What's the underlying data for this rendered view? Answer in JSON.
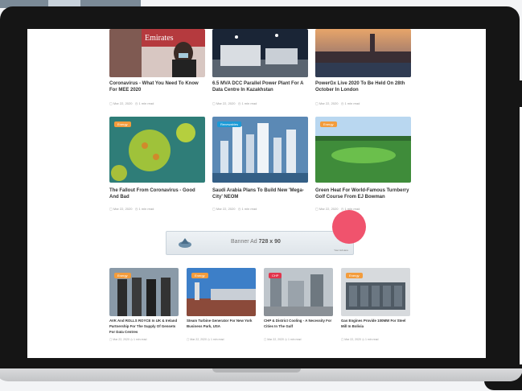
{
  "row1": [
    {
      "title": "Coronavirus - What You Need To Know For MEE 2020",
      "date": "Mar 22, 2020",
      "read": "1 min read"
    },
    {
      "title": "6.5 MVA DCC Parallel Power Plant For A Data Centre In Kazakhstan",
      "date": "Mar 22, 2020",
      "read": "1 min read"
    },
    {
      "title": "PowerGx Live 2020 To Be Held On 28th October In London",
      "date": "Mar 22, 2020",
      "read": "1 min read"
    }
  ],
  "row2": [
    {
      "title": "The Fallout From Coronavirus - Good And Bad",
      "date": "Mar 22, 2020",
      "read": "1 min read",
      "badge": "Energy"
    },
    {
      "title": "Saudi Arabia Plans To Build New 'Mega-City' NEOM",
      "date": "Mar 22, 2020",
      "read": "1 min read",
      "badge": "Renewables"
    },
    {
      "title": "Green Heat For World-Famous Turnberry Golf Course From EJ Bowman",
      "date": "Mar 22, 2020",
      "read": "1 min read",
      "badge": "Energy"
    }
  ],
  "banner": {
    "text": "Banner Ad",
    "size": "728 x 90",
    "small": "Your Ad Here"
  },
  "row3": [
    {
      "title": "AVK And ROLLS ROYCE In UK & Ireland Partnership For The Supply Of Gensets For Data Centres",
      "date": "Mar 22, 2020",
      "read": "1 min read",
      "badge": "Energy"
    },
    {
      "title": "Steam Turbine Generator For New York Business Park, USA",
      "date": "Mar 22, 2020",
      "read": "1 min read",
      "badge": "Energy"
    },
    {
      "title": "CHP & District Cooling - A Necessity For Cities In The Gulf",
      "date": "Mar 22, 2020",
      "read": "1 min read",
      "badge": "CHP"
    },
    {
      "title": "Gas Engines Provide 100MW For Steel Mill In Bolivia",
      "date": "Mar 22, 2020",
      "read": "1 min read",
      "badge": "Energy"
    }
  ],
  "images": {
    "r1_0": "Emirates"
  }
}
